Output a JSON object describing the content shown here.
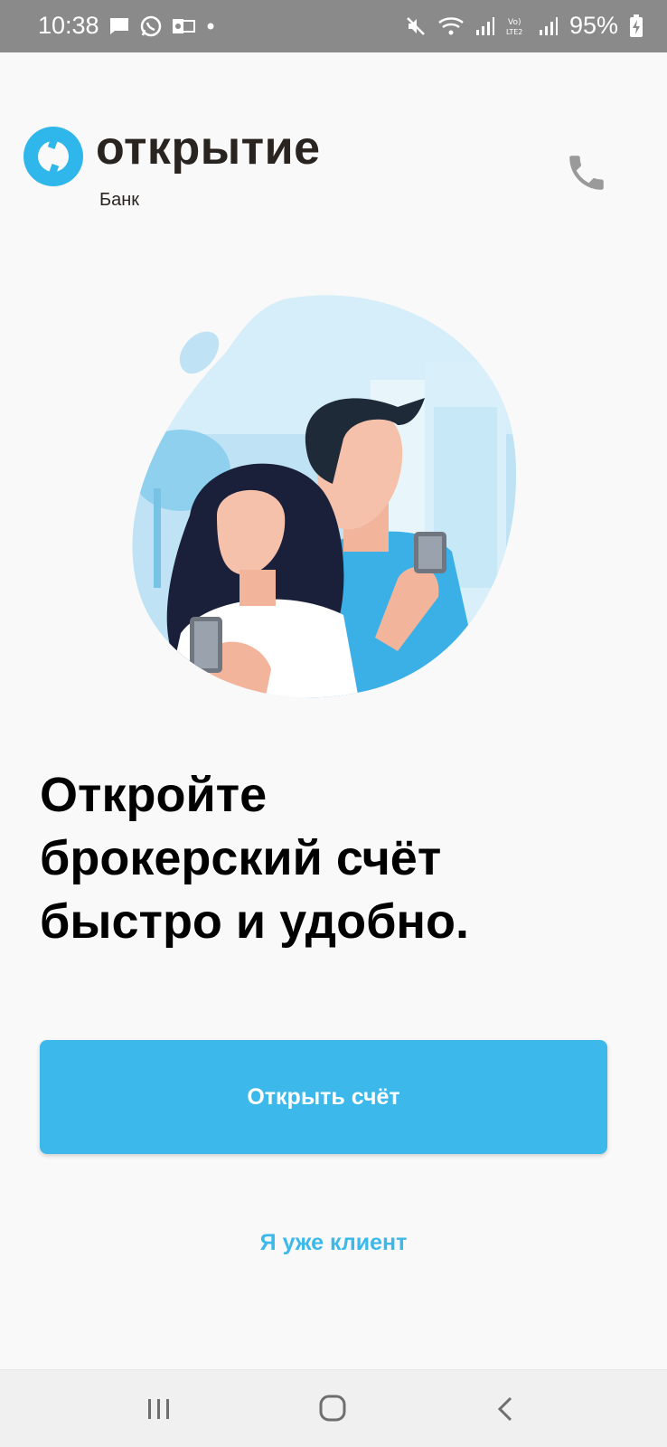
{
  "status_bar": {
    "time": "10:38",
    "battery": "95%",
    "icons": [
      "message-icon",
      "whatsapp-icon",
      "outlook-icon",
      "dot-icon",
      "mute-icon",
      "wifi-icon",
      "signal-icon",
      "volte-icon",
      "signal-icon",
      "battery-charging-icon"
    ]
  },
  "header": {
    "brand_name": "открытие",
    "brand_sub": "Банк",
    "phone_icon": "phone-icon"
  },
  "main": {
    "headline_lines": [
      "Откройте",
      "брокерский счёт",
      "быстро и удобно."
    ],
    "primary_button": "Открыть счёт",
    "secondary_link": "Я уже клиент"
  },
  "nav": {
    "icons": [
      "recent-apps-icon",
      "home-icon",
      "back-icon"
    ]
  },
  "colors": {
    "accent": "#3db8ea",
    "brand_blue": "#2fb6ea",
    "status_bar": "#8a8a8a"
  }
}
